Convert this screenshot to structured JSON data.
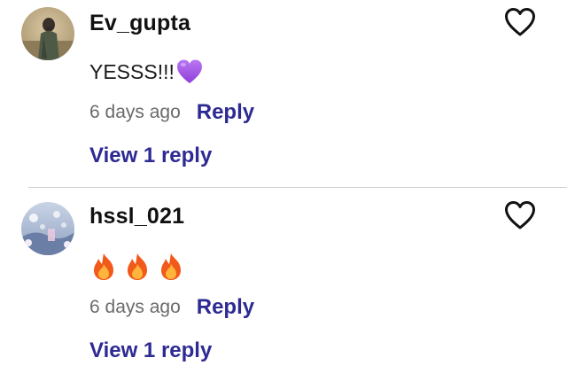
{
  "comments": [
    {
      "username": "Ev_gupta",
      "text": "YESSS!!!",
      "emoji": "purple-heart",
      "time": "6 days ago",
      "reply_label": "Reply",
      "view_replies_label": "View 1 reply",
      "avatar": "avatar-photo-person"
    },
    {
      "username": "hssl_021",
      "text": "",
      "emoji": "fire",
      "emoji_count": 3,
      "time": "6 days ago",
      "reply_label": "Reply",
      "view_replies_label": "View 1 reply",
      "avatar": "avatar-photo-winter-scene"
    }
  ],
  "icons": {
    "like": "heart-outline-icon"
  },
  "colors": {
    "link": "#2e2a93",
    "timestamp": "#6b6b6b",
    "divider": "#cfcfcf",
    "purple_heart": "#a259e6",
    "fire_outer": "#f25a1c",
    "fire_inner": "#ffb43b"
  }
}
